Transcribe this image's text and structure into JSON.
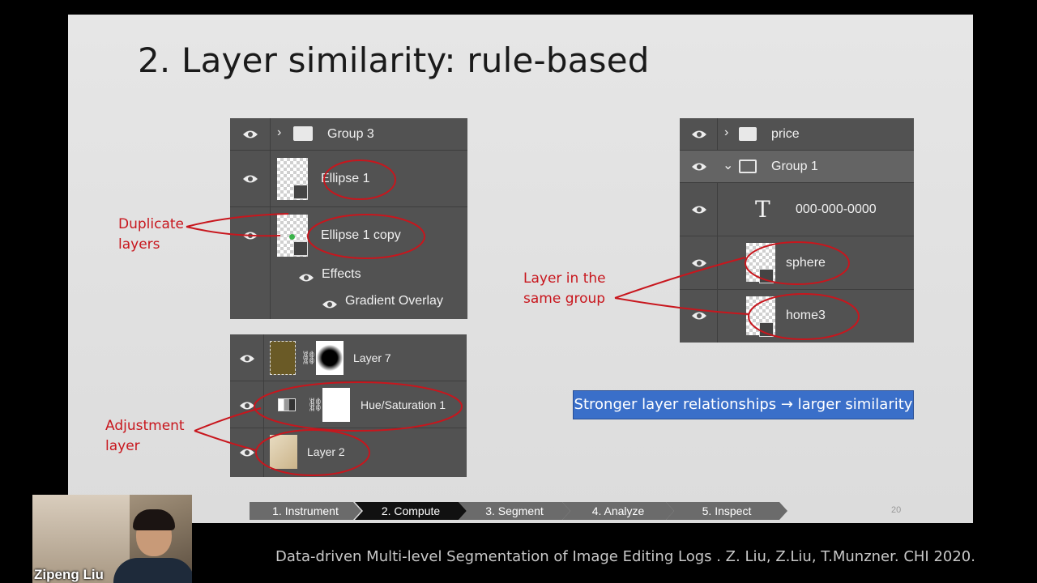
{
  "slide": {
    "title": "2. Layer similarity: rule-based",
    "page_number": "20"
  },
  "panel_group3": {
    "rows": {
      "group3": "Group 3",
      "ellipse1": "Ellipse 1",
      "ellipse1_copy": "Ellipse 1 copy",
      "effects": "Effects",
      "gradient_overlay": "Gradient Overlay"
    }
  },
  "panel_adjust": {
    "rows": {
      "layer7": "Layer 7",
      "hue_sat": "Hue/Saturation 1",
      "layer2": "Layer 2"
    }
  },
  "panel_price": {
    "rows": {
      "price": "price",
      "group1": "Group 1",
      "text_layer": "000-000-0000",
      "sphere": "sphere",
      "home3": "home3"
    }
  },
  "annotations": {
    "duplicate": "Duplicate layers",
    "adjustment": "Adjustment layer",
    "same_group": "Layer in the same group"
  },
  "callout": "Stronger layer relationships → larger similarity",
  "stepper": [
    "1. Instrument",
    "2. Compute",
    "3. Segment",
    "4. Analyze",
    "5. Inspect"
  ],
  "stepper_active": "2. Compute",
  "footer": "Data-driven Multi-level Segmentation of Image Editing Logs .  Z. Liu, Z.Liu, T.Munzner.   CHI 2020.",
  "speaker": {
    "name": "Zipeng Liu"
  },
  "colors": {
    "annotation": "#c8161d",
    "panel": "#525252",
    "callout": "#3a6fc9",
    "active_step": "#111111"
  }
}
